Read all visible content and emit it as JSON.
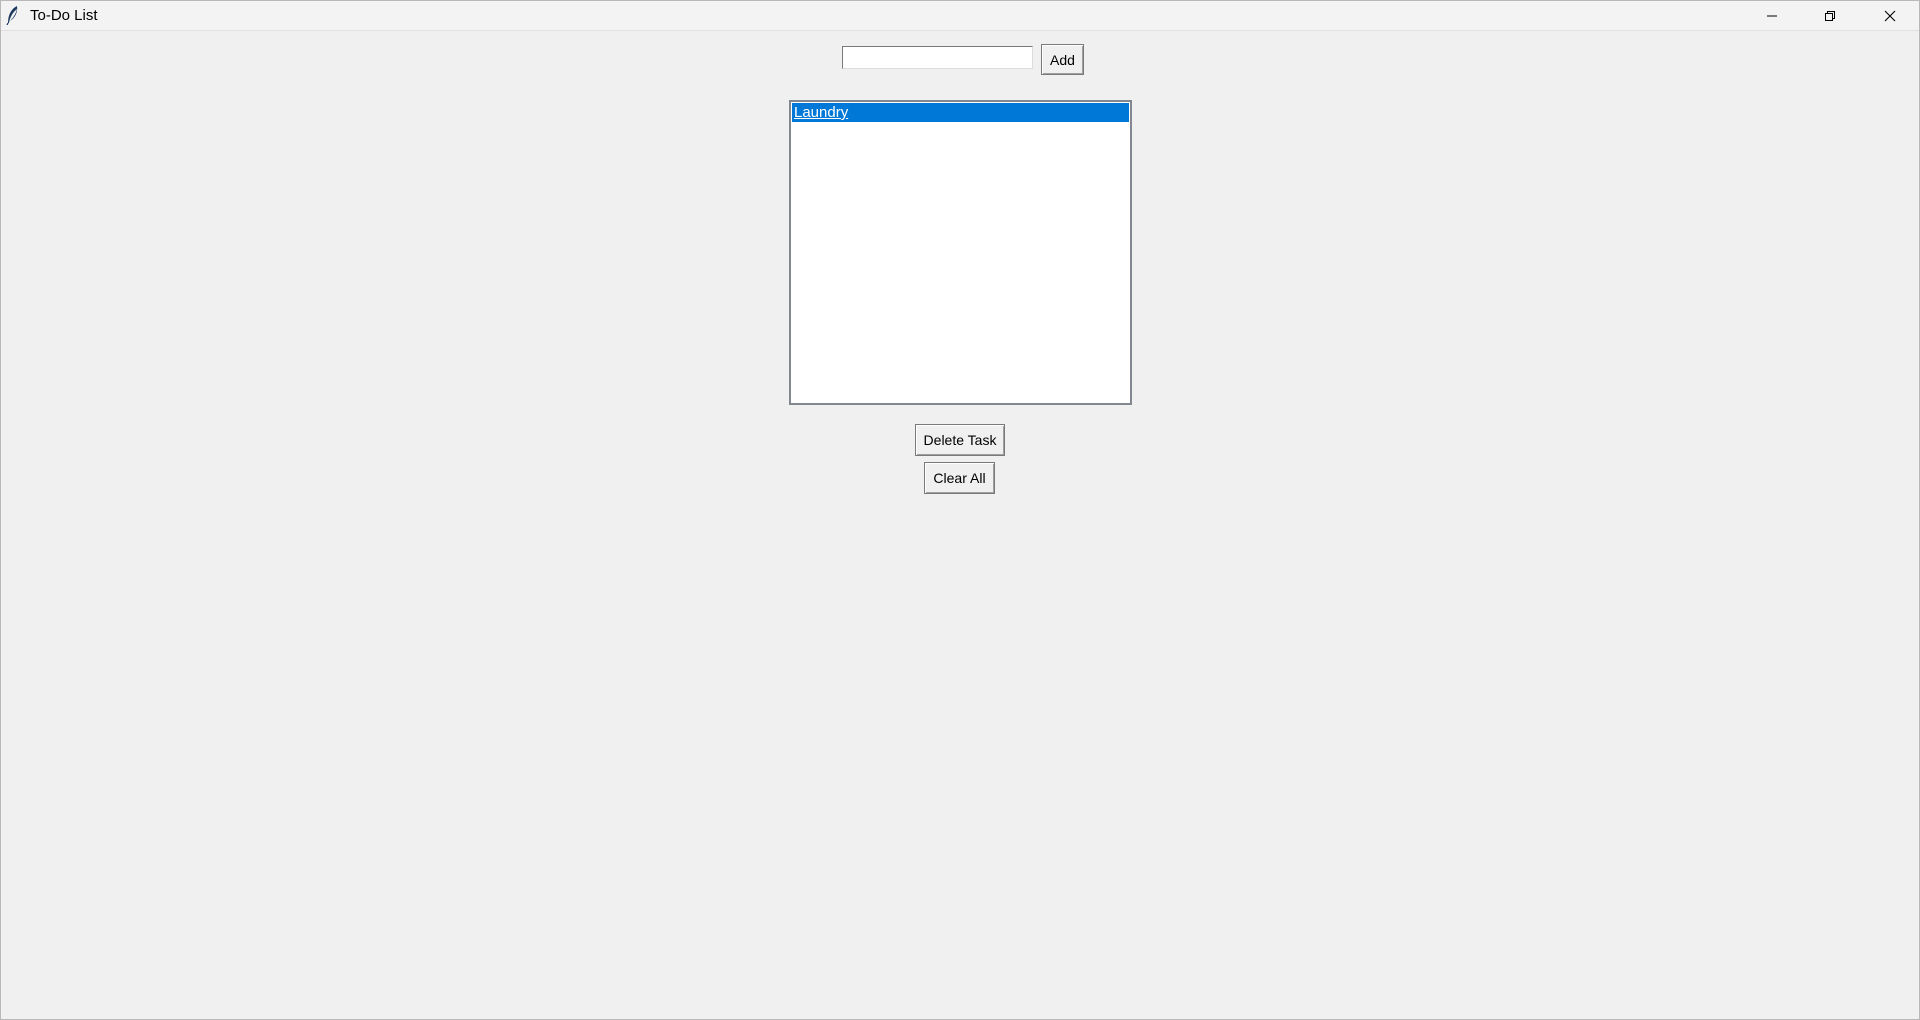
{
  "window": {
    "title": "To-Do List",
    "icons": {
      "app": "feather-icon",
      "minimize": "minimize-icon",
      "maximize": "restore-icon",
      "close": "close-icon"
    }
  },
  "entry": {
    "value": "",
    "placeholder": ""
  },
  "buttons": {
    "add_label": "Add",
    "delete_label": "Delete Task",
    "clear_label": "Clear All"
  },
  "tasks": [
    {
      "label": "Laundry",
      "selected": true
    }
  ],
  "colors": {
    "selection": "#0078d7",
    "background": "#f0f0f0",
    "list_background": "#ffffff"
  }
}
